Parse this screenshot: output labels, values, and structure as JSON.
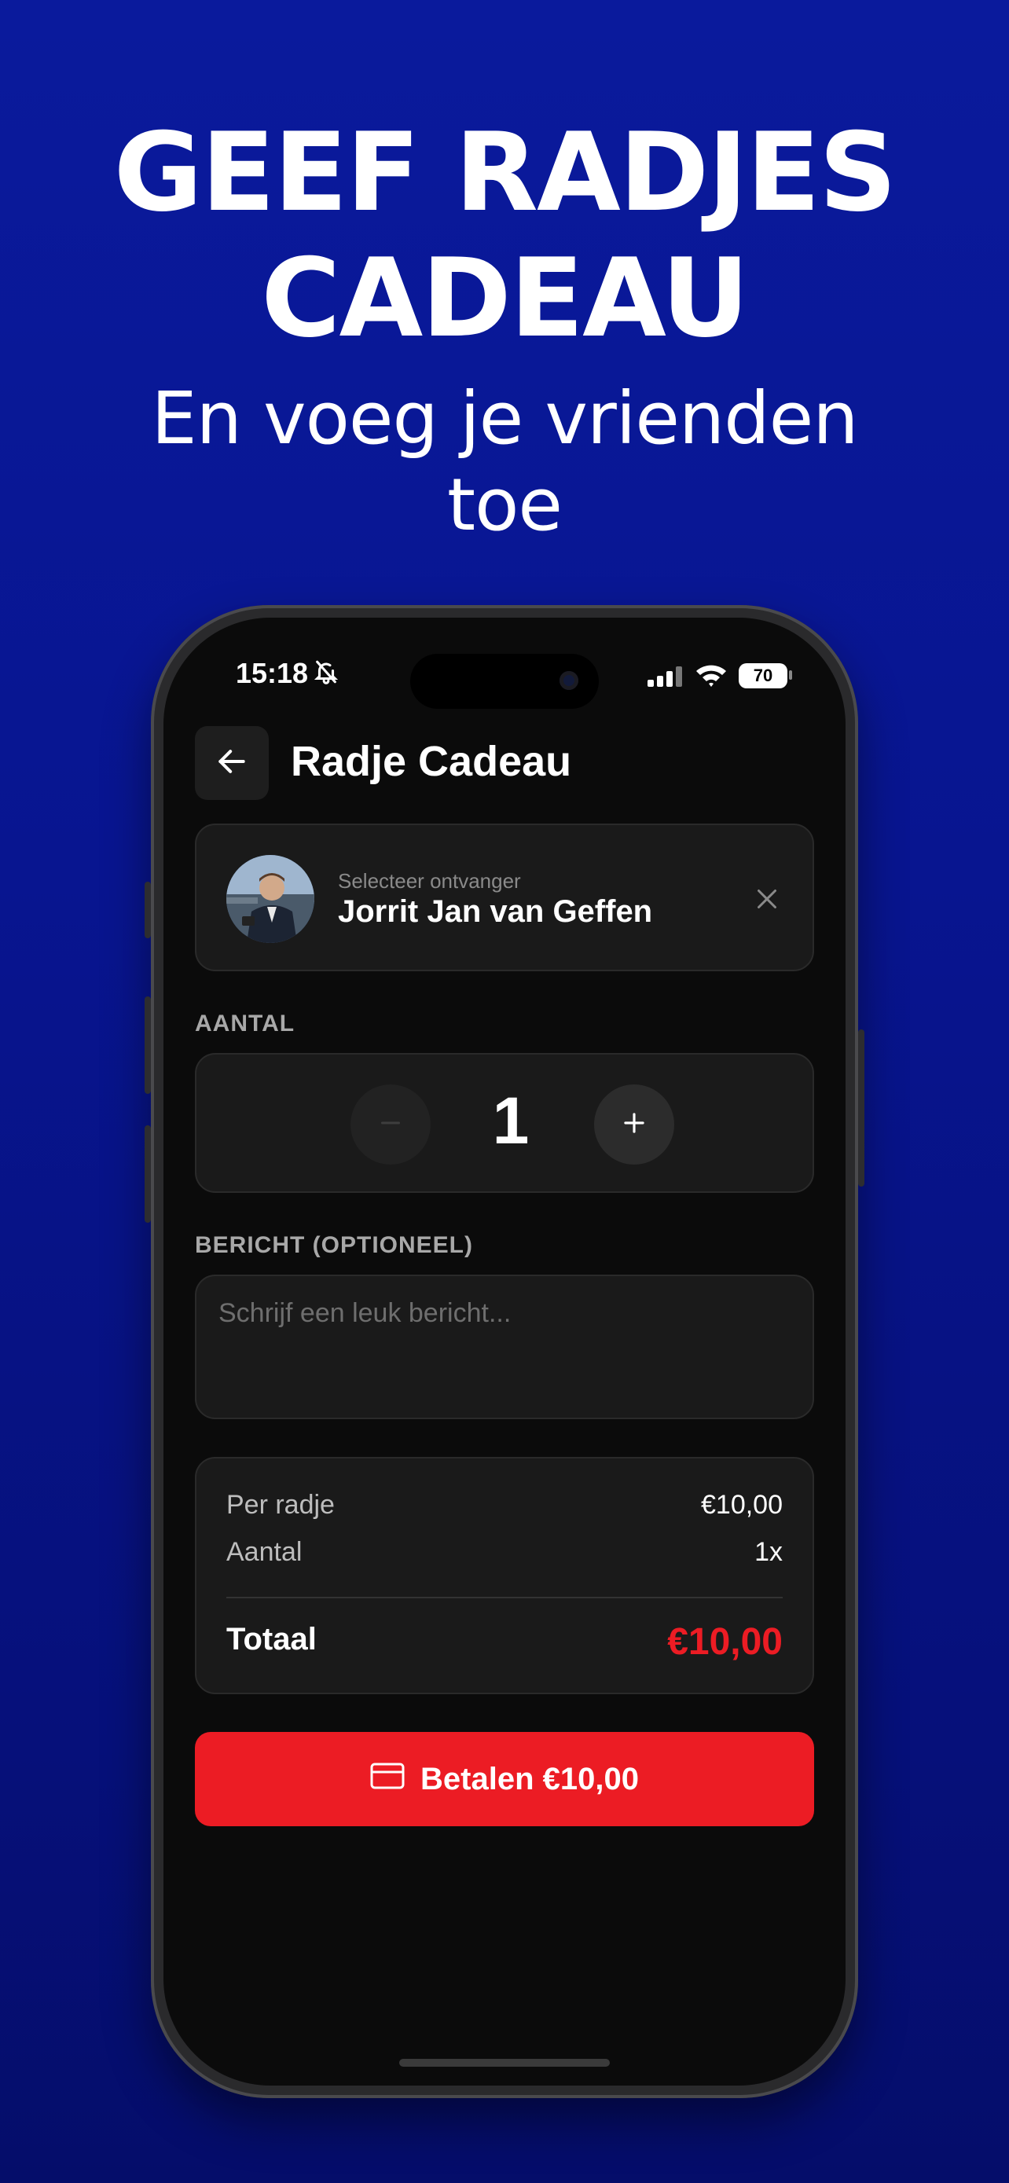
{
  "promo": {
    "headline_line1": "GEEF RADJES",
    "headline_line2": "CADEAU",
    "subline_line1": "En voeg je vrienden",
    "subline_line2": "toe"
  },
  "status_bar": {
    "time": "15:18",
    "battery": "70",
    "icons": [
      "bell-slash-icon",
      "cellular-signal-icon",
      "wifi-icon",
      "battery-icon"
    ]
  },
  "header": {
    "title": "Radje Cadeau",
    "back_icon": "arrow-left-icon"
  },
  "recipient": {
    "label": "Selecteer ontvanger",
    "name": "Jorrit Jan van Geffen",
    "clear_icon": "close-icon"
  },
  "quantity": {
    "section_label": "AANTAL",
    "value": "1",
    "minus_label": "−",
    "plus_label": "+"
  },
  "message": {
    "section_label": "BERICHT (OPTIONEEL)",
    "placeholder": "Schrijf een leuk bericht...",
    "value": ""
  },
  "summary": {
    "rows": [
      {
        "label": "Per radje",
        "value": "€10,00"
      },
      {
        "label": "Aantal",
        "value": "1x"
      }
    ],
    "total_label": "Totaal",
    "total_value": "€10,00"
  },
  "pay_button": {
    "label": "Betalen €10,00",
    "icon": "credit-card-icon"
  },
  "colors": {
    "accent_red": "#ec1c24",
    "background_blue": "#0a1a9c",
    "screen_bg": "#0b0b0b",
    "card_bg": "#1a1a1a"
  }
}
